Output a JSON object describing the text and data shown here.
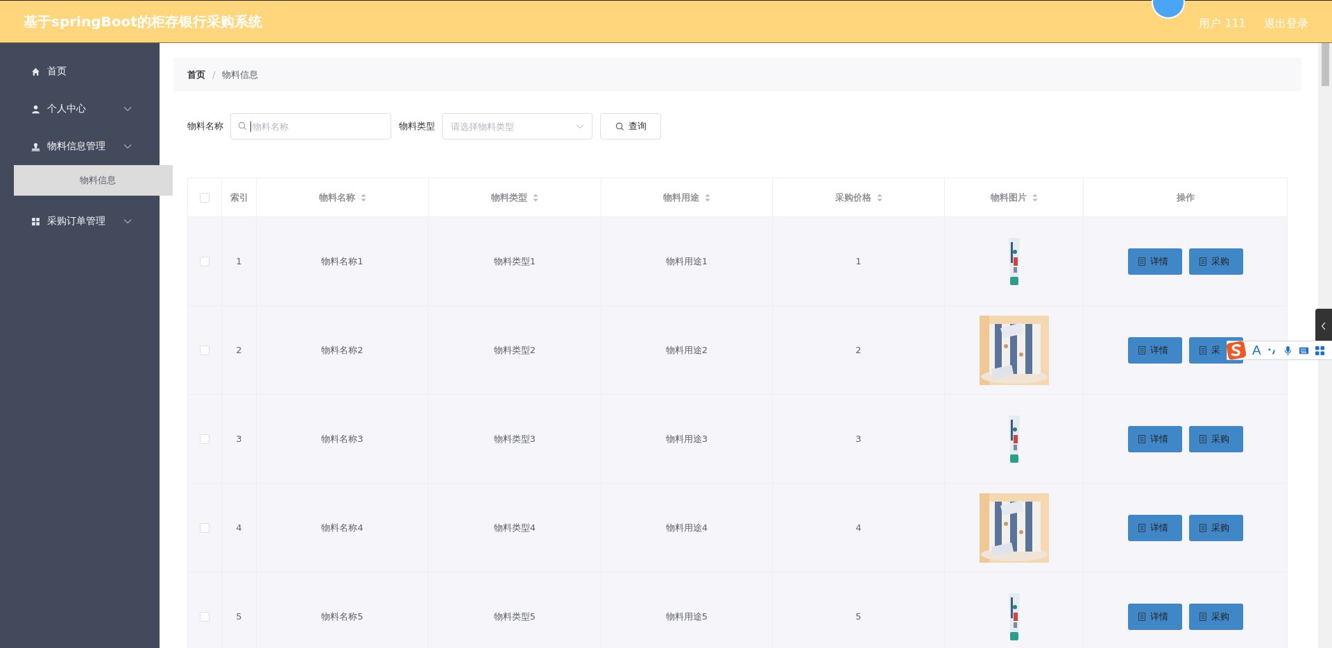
{
  "header": {
    "title": "基于springBoot的柜存银行采购系统",
    "user": "用户 111",
    "logout": "退出登录"
  },
  "sidebar": {
    "items": [
      {
        "label": "首页",
        "kind": "link"
      },
      {
        "label": "个人中心",
        "kind": "submenu"
      },
      {
        "label": "物料信息管理",
        "kind": "submenu",
        "children": [
          {
            "label": "物料信息",
            "selected": true
          }
        ]
      },
      {
        "label": "采购订单管理",
        "kind": "submenu"
      }
    ]
  },
  "breadcrumb": {
    "separator": "/",
    "items": [
      "首页",
      "物料信息"
    ]
  },
  "search": {
    "fields": [
      {
        "label": "物料名称",
        "kind": "input",
        "placeholder": "物料名称"
      },
      {
        "label": "物料类型",
        "kind": "select",
        "placeholder": "请选择物料类型"
      }
    ],
    "button": "查询"
  },
  "table": {
    "all_checked": false,
    "columns": [
      {
        "label": "索引",
        "sortable": false
      },
      {
        "label": "物料名称",
        "sortable": true
      },
      {
        "label": "物料类型",
        "sortable": true
      },
      {
        "label": "物料用途",
        "sortable": true
      },
      {
        "label": "采购价格",
        "sortable": true
      },
      {
        "label": "物料图片",
        "sortable": true
      },
      {
        "label": "操作",
        "sortable": false
      }
    ],
    "rows": [
      {
        "checked": false,
        "index": "1",
        "name": "物料名称1",
        "type": "物料类型1",
        "use": "物料用途1",
        "price": "1",
        "actions": [
          "详情",
          "采购"
        ]
      },
      {
        "checked": false,
        "index": "2",
        "name": "物料名称2",
        "type": "物料类型2",
        "use": "物料用途2",
        "price": "2",
        "actions": [
          "详情",
          "采"
        ]
      },
      {
        "checked": false,
        "index": "3",
        "name": "物料名称3",
        "type": "物料类型3",
        "use": "物料用途3",
        "price": "3",
        "actions": [
          "详情",
          "采购"
        ]
      },
      {
        "checked": false,
        "index": "4",
        "name": "物料名称4",
        "type": "物料类型4",
        "use": "物料用途4",
        "price": "4",
        "actions": [
          "详情",
          "采购"
        ]
      },
      {
        "checked": false,
        "index": "5",
        "name": "物料名称5",
        "type": "物料类型5",
        "use": "物料用途5",
        "price": "5",
        "actions": [
          "详情",
          "采购"
        ]
      }
    ]
  },
  "ime_toolbar": {
    "mode": "A"
  }
}
